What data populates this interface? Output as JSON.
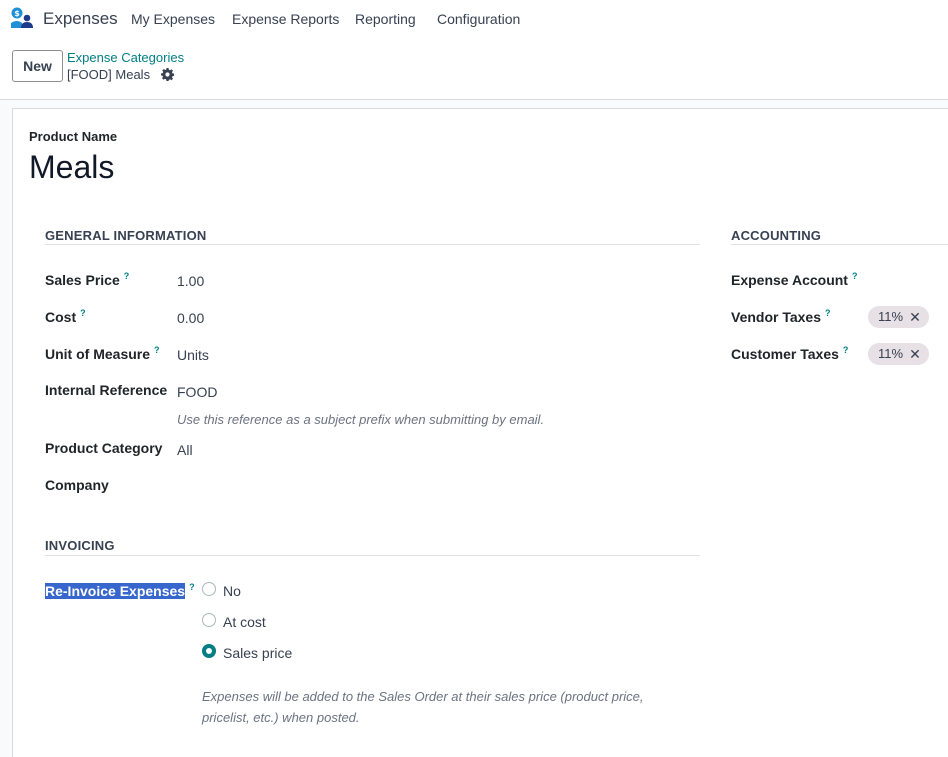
{
  "navbar": {
    "app_name": "Expenses",
    "menu": [
      "My Expenses",
      "Expense Reports",
      "Reporting",
      "Configuration"
    ],
    "logo_icon": "expenses-app-logo"
  },
  "control_panel": {
    "new_label": "New",
    "breadcrumb_parent": "Expense Categories",
    "record_title": "[FOOD] Meals",
    "settings_icon": "gear-icon"
  },
  "form": {
    "product_name_label": "Product Name",
    "product_name": "Meals",
    "general_information": {
      "title": "GENERAL INFORMATION",
      "sales_price_label": "Sales Price",
      "sales_price": "1.00",
      "cost_label": "Cost",
      "cost": "0.00",
      "uom_label": "Unit of Measure",
      "uom": "Units",
      "internal_ref_label": "Internal Reference",
      "internal_ref": "FOOD",
      "internal_ref_help": "Use this reference as a subject prefix when submitting by email.",
      "category_label": "Product Category",
      "category": "All",
      "company_label": "Company",
      "company": ""
    },
    "accounting": {
      "title": "ACCOUNTING",
      "expense_account_label": "Expense Account",
      "vendor_taxes_label": "Vendor Taxes",
      "vendor_taxes": [
        "11%"
      ],
      "customer_taxes_label": "Customer Taxes",
      "customer_taxes": [
        "11%"
      ]
    },
    "invoicing": {
      "title": "INVOICING",
      "reinvoice_label": "Re-Invoice Expenses",
      "options": [
        "No",
        "At cost",
        "Sales price"
      ],
      "selected": "Sales price",
      "help": "Expenses will be added to the Sales Order at their sales price (product price, pricelist, etc.) when posted."
    },
    "help_marker": "?",
    "remove_glyph": "✕"
  },
  "colors": {
    "accent": "#017e84",
    "selection": "#3766cc",
    "tag_bg": "#e7e0e4"
  }
}
